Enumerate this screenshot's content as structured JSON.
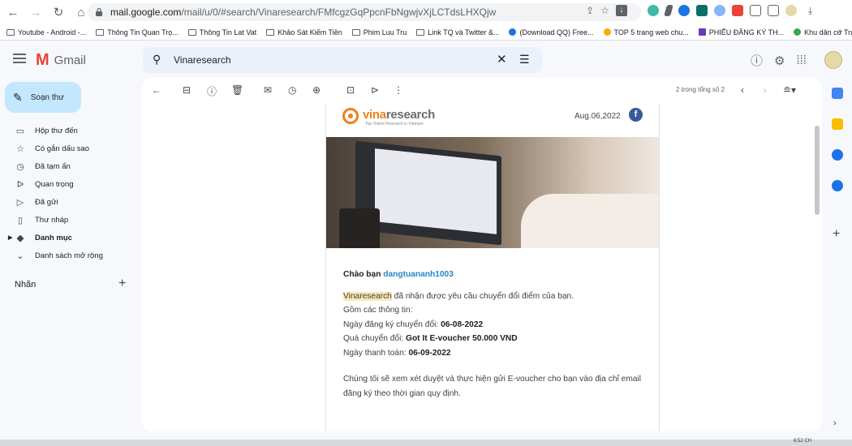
{
  "browser": {
    "url_host": "mail.google.com",
    "url_path": "/mail/u/0/#search/Vinaresearch/FMfcgzGqPpcnFbNgwjvXjLCTdsLHXQjw",
    "bookmarks": [
      {
        "label": "Youtube - Android -..."
      },
      {
        "label": "Thông Tin Quan Trọ..."
      },
      {
        "label": "Thông Tin Lat Vat"
      },
      {
        "label": "Khảo Sát Kiếm Tiền"
      },
      {
        "label": "Phim Luu Tru"
      },
      {
        "label": "Link TQ và Twitter &..."
      },
      {
        "label": "(Download QQ) Free..."
      },
      {
        "label": "TOP 5 trang web chu..."
      },
      {
        "label": "PHIẾU ĐĂNG KÝ TH..."
      },
      {
        "label": "Khu dân cư Trường S..."
      }
    ]
  },
  "gmail": {
    "app_name": "Gmail",
    "search_query": "Vinaresearch",
    "compose_label": "Soạn thư",
    "nav": [
      {
        "label": "Hộp thư đến",
        "icon": "inbox-icon"
      },
      {
        "label": "Có gắn dấu sao",
        "icon": "star-icon"
      },
      {
        "label": "Đã tạm ẩn",
        "icon": "clock-icon"
      },
      {
        "label": "Quan trọng",
        "icon": "important-icon"
      },
      {
        "label": "Đã gửi",
        "icon": "send-icon"
      },
      {
        "label": "Thư nháp",
        "icon": "draft-icon"
      },
      {
        "label": "Danh mục",
        "icon": "label-icon"
      },
      {
        "label": "Danh sách mở rộng",
        "icon": "chevron-down-icon"
      }
    ],
    "labels_title": "Nhãn",
    "pager_text": "2 trong tổng số 2"
  },
  "email": {
    "brand_prefix": "vina",
    "brand_suffix": "research",
    "brand_tagline": "Top Online Research in Vietnam",
    "date": "Aug.06,2022",
    "greeting": "Chào bạn",
    "username": "dangtuananh1003",
    "highlight": "Vinaresearch",
    "line1_rest": " đã nhận được yêu cầu chuyển đổi điểm của bạn.",
    "line2": "Gồm các thông tin:",
    "reg_label": "Ngày đăng ký chuyển đổi: ",
    "reg_value": "06-08-2022",
    "gift_label": "Quà chuyển đổi: ",
    "gift_value": "Got It E-voucher 50.000 VND",
    "pay_label": "Ngày thanh toán: ",
    "pay_value": "06-09-2022",
    "closing": "Chúng tôi sẽ xem xét duyệt và thực hiện gửi E-voucher cho bạn vào địa chỉ email đăng ký theo thời gian quy định."
  },
  "taskbar": {
    "time": "6:52 CH"
  }
}
